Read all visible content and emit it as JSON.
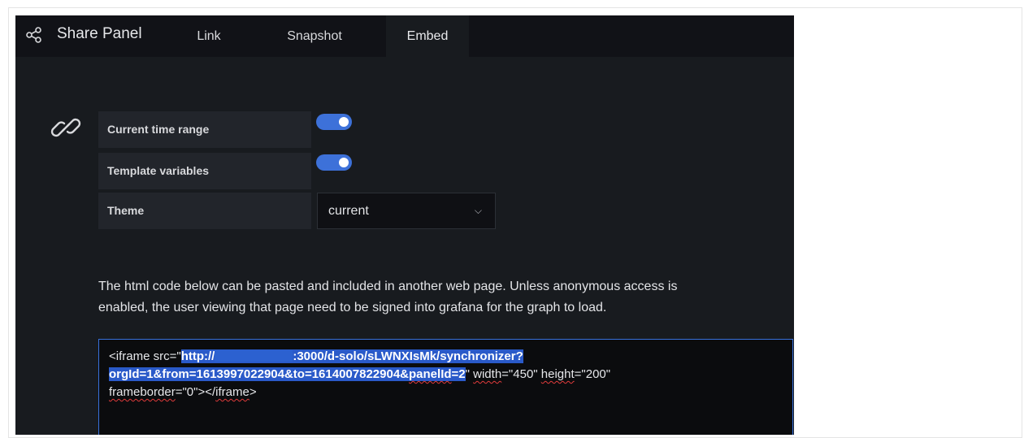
{
  "panel": {
    "title": "Share Panel",
    "tabs": [
      {
        "label": "Link"
      },
      {
        "label": "Snapshot"
      },
      {
        "label": "Embed",
        "active": true
      }
    ]
  },
  "options": {
    "current_time_range": {
      "label": "Current time range",
      "enabled": true
    },
    "template_variables": {
      "label": "Template variables",
      "enabled": true
    },
    "theme": {
      "label": "Theme",
      "value": "current"
    }
  },
  "description": {
    "line1": "The html code below can be pasted and included in another web page. Unless anonymous access is",
    "line2": "enabled, the user viewing that page need to be signed into grafana for the graph to load."
  },
  "embed_code": {
    "line1_prefix": "<iframe src=\"",
    "line1_url_start": "http://",
    "line1_url_rest": ":3000/d-solo/sLWNXIsMk/synchronizer?",
    "line2_url_a": "orgId=1&from=1613997022904&to=1614007822904&",
    "line2_url_b": "panelId",
    "line2_url_c": "=2",
    "line2_q": "\"",
    "line2_w_attr": "width",
    "line2_w_val": "=\"450\"",
    "line2_h_attr": "height",
    "line2_h_val": "=\"200\"",
    "line3_fb": "frameborder",
    "line3_mid": "=\"0\"></",
    "line3_tag": "iframe",
    "line3_end": ">"
  },
  "colors": {
    "accent": "#3d71d9",
    "panel_bg": "#181b1f",
    "header_bg": "#111217",
    "selection": "#2a5ac9"
  },
  "icons": [
    "share-icon",
    "link-icon",
    "chevron-down-icon"
  ]
}
